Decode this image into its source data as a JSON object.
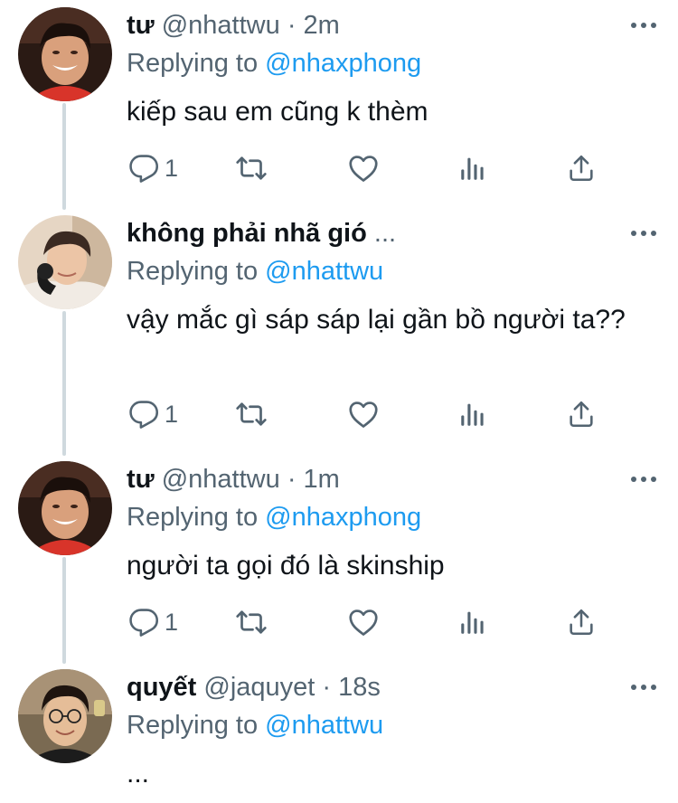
{
  "tweets": [
    {
      "name": "tư",
      "handle": "@nhattwu",
      "separator": "·",
      "time": "2m",
      "replying_prefix": "Replying to",
      "replying_to": "@nhaxphong",
      "text": "kiếp sau em cũng k thèm",
      "reply_count": "1",
      "icons": [
        "reply-icon",
        "retweet-icon",
        "like-icon",
        "analytics-icon",
        "share-icon"
      ]
    },
    {
      "name": "không phải nhã gió",
      "name_suffix": "...",
      "replying_prefix": "Replying to",
      "replying_to": "@nhattwu",
      "text": "vậy mắc gì sáp sáp lại gần bồ người ta??",
      "reply_count": "1",
      "icons": [
        "reply-icon",
        "retweet-icon",
        "like-icon",
        "analytics-icon",
        "share-icon"
      ]
    },
    {
      "name": "tư",
      "handle": "@nhattwu",
      "separator": "·",
      "time": "1m",
      "replying_prefix": "Replying to",
      "replying_to": "@nhaxphong",
      "text": "người ta gọi đó là skinship",
      "reply_count": "1",
      "icons": [
        "reply-icon",
        "retweet-icon",
        "like-icon",
        "analytics-icon",
        "share-icon"
      ]
    },
    {
      "name": "quyết",
      "handle": "@jaquyet",
      "separator": "·",
      "time": "18s",
      "replying_prefix": "Replying to",
      "replying_to": "@nhattwu",
      "text": "..."
    }
  ],
  "colors": {
    "text": "#0f1419",
    "secondary": "#536471",
    "link": "#1d9bf0",
    "thread_line": "#cfd9de"
  }
}
